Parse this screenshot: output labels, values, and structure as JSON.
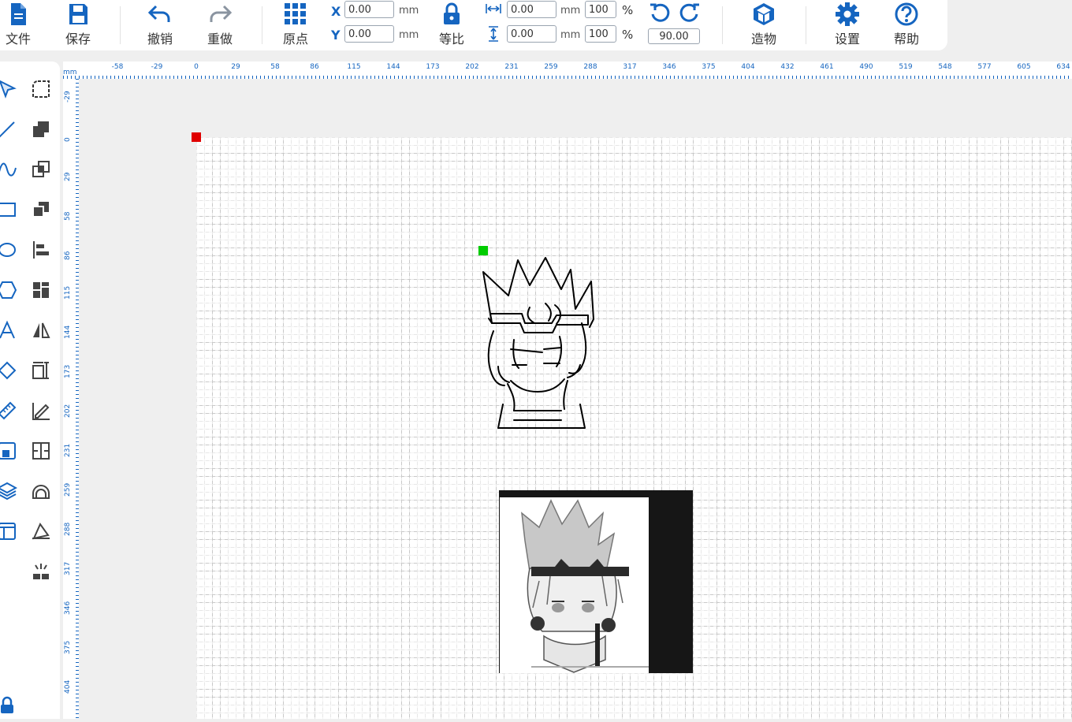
{
  "toolbar": {
    "file_label": "文件",
    "save_label": "保存",
    "undo_label": "撤销",
    "redo_label": "重做",
    "origin_label": "原点",
    "x_label": "X",
    "y_label": "Y",
    "x_value": "0.00",
    "y_value": "0.00",
    "unit_mm": "mm",
    "lock_label": "等比",
    "width_value": "0.00",
    "height_value": "0.00",
    "width_pct": "100",
    "height_pct": "100",
    "pct_symbol": "%",
    "rotate_value": "90.00",
    "build_label": "造物",
    "settings_label": "设置",
    "help_label": "帮助"
  },
  "ruler": {
    "unit": "mm",
    "top_ticks": [
      "-58",
      "-29",
      "0",
      "29",
      "58",
      "86",
      "115",
      "144",
      "173",
      "202",
      "231",
      "259",
      "288",
      "317",
      "346",
      "375",
      "404",
      "432",
      "461",
      "490",
      "519",
      "548",
      "577",
      "605",
      "634"
    ],
    "left_ticks": [
      "-29",
      "0",
      "29",
      "58",
      "86",
      "115",
      "144",
      "173",
      "202",
      "231",
      "259",
      "288",
      "317",
      "346",
      "375",
      "404"
    ]
  },
  "colors": {
    "accent": "#1565c0",
    "origin_marker": "#e00000",
    "selection_marker": "#00cc00"
  }
}
